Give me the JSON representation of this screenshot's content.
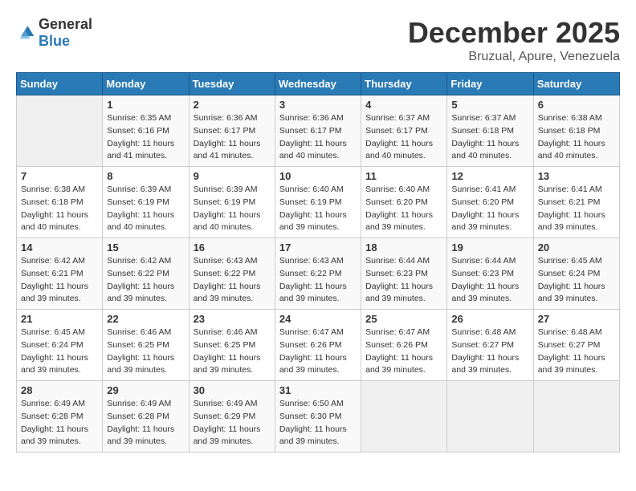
{
  "logo": {
    "general": "General",
    "blue": "Blue"
  },
  "title": "December 2025",
  "location": "Bruzual, Apure, Venezuela",
  "days_of_week": [
    "Sunday",
    "Monday",
    "Tuesday",
    "Wednesday",
    "Thursday",
    "Friday",
    "Saturday"
  ],
  "weeks": [
    [
      {
        "day": "",
        "info": ""
      },
      {
        "day": "1",
        "info": "Sunrise: 6:35 AM\nSunset: 6:16 PM\nDaylight: 11 hours\nand 41 minutes."
      },
      {
        "day": "2",
        "info": "Sunrise: 6:36 AM\nSunset: 6:17 PM\nDaylight: 11 hours\nand 41 minutes."
      },
      {
        "day": "3",
        "info": "Sunrise: 6:36 AM\nSunset: 6:17 PM\nDaylight: 11 hours\nand 40 minutes."
      },
      {
        "day": "4",
        "info": "Sunrise: 6:37 AM\nSunset: 6:17 PM\nDaylight: 11 hours\nand 40 minutes."
      },
      {
        "day": "5",
        "info": "Sunrise: 6:37 AM\nSunset: 6:18 PM\nDaylight: 11 hours\nand 40 minutes."
      },
      {
        "day": "6",
        "info": "Sunrise: 6:38 AM\nSunset: 6:18 PM\nDaylight: 11 hours\nand 40 minutes."
      }
    ],
    [
      {
        "day": "7",
        "info": "Sunrise: 6:38 AM\nSunset: 6:18 PM\nDaylight: 11 hours\nand 40 minutes."
      },
      {
        "day": "8",
        "info": "Sunrise: 6:39 AM\nSunset: 6:19 PM\nDaylight: 11 hours\nand 40 minutes."
      },
      {
        "day": "9",
        "info": "Sunrise: 6:39 AM\nSunset: 6:19 PM\nDaylight: 11 hours\nand 40 minutes."
      },
      {
        "day": "10",
        "info": "Sunrise: 6:40 AM\nSunset: 6:19 PM\nDaylight: 11 hours\nand 39 minutes."
      },
      {
        "day": "11",
        "info": "Sunrise: 6:40 AM\nSunset: 6:20 PM\nDaylight: 11 hours\nand 39 minutes."
      },
      {
        "day": "12",
        "info": "Sunrise: 6:41 AM\nSunset: 6:20 PM\nDaylight: 11 hours\nand 39 minutes."
      },
      {
        "day": "13",
        "info": "Sunrise: 6:41 AM\nSunset: 6:21 PM\nDaylight: 11 hours\nand 39 minutes."
      }
    ],
    [
      {
        "day": "14",
        "info": "Sunrise: 6:42 AM\nSunset: 6:21 PM\nDaylight: 11 hours\nand 39 minutes."
      },
      {
        "day": "15",
        "info": "Sunrise: 6:42 AM\nSunset: 6:22 PM\nDaylight: 11 hours\nand 39 minutes."
      },
      {
        "day": "16",
        "info": "Sunrise: 6:43 AM\nSunset: 6:22 PM\nDaylight: 11 hours\nand 39 minutes."
      },
      {
        "day": "17",
        "info": "Sunrise: 6:43 AM\nSunset: 6:22 PM\nDaylight: 11 hours\nand 39 minutes."
      },
      {
        "day": "18",
        "info": "Sunrise: 6:44 AM\nSunset: 6:23 PM\nDaylight: 11 hours\nand 39 minutes."
      },
      {
        "day": "19",
        "info": "Sunrise: 6:44 AM\nSunset: 6:23 PM\nDaylight: 11 hours\nand 39 minutes."
      },
      {
        "day": "20",
        "info": "Sunrise: 6:45 AM\nSunset: 6:24 PM\nDaylight: 11 hours\nand 39 minutes."
      }
    ],
    [
      {
        "day": "21",
        "info": "Sunrise: 6:45 AM\nSunset: 6:24 PM\nDaylight: 11 hours\nand 39 minutes."
      },
      {
        "day": "22",
        "info": "Sunrise: 6:46 AM\nSunset: 6:25 PM\nDaylight: 11 hours\nand 39 minutes."
      },
      {
        "day": "23",
        "info": "Sunrise: 6:46 AM\nSunset: 6:25 PM\nDaylight: 11 hours\nand 39 minutes."
      },
      {
        "day": "24",
        "info": "Sunrise: 6:47 AM\nSunset: 6:26 PM\nDaylight: 11 hours\nand 39 minutes."
      },
      {
        "day": "25",
        "info": "Sunrise: 6:47 AM\nSunset: 6:26 PM\nDaylight: 11 hours\nand 39 minutes."
      },
      {
        "day": "26",
        "info": "Sunrise: 6:48 AM\nSunset: 6:27 PM\nDaylight: 11 hours\nand 39 minutes."
      },
      {
        "day": "27",
        "info": "Sunrise: 6:48 AM\nSunset: 6:27 PM\nDaylight: 11 hours\nand 39 minutes."
      }
    ],
    [
      {
        "day": "28",
        "info": "Sunrise: 6:49 AM\nSunset: 6:28 PM\nDaylight: 11 hours\nand 39 minutes."
      },
      {
        "day": "29",
        "info": "Sunrise: 6:49 AM\nSunset: 6:28 PM\nDaylight: 11 hours\nand 39 minutes."
      },
      {
        "day": "30",
        "info": "Sunrise: 6:49 AM\nSunset: 6:29 PM\nDaylight: 11 hours\nand 39 minutes."
      },
      {
        "day": "31",
        "info": "Sunrise: 6:50 AM\nSunset: 6:30 PM\nDaylight: 11 hours\nand 39 minutes."
      },
      {
        "day": "",
        "info": ""
      },
      {
        "day": "",
        "info": ""
      },
      {
        "day": "",
        "info": ""
      }
    ]
  ]
}
